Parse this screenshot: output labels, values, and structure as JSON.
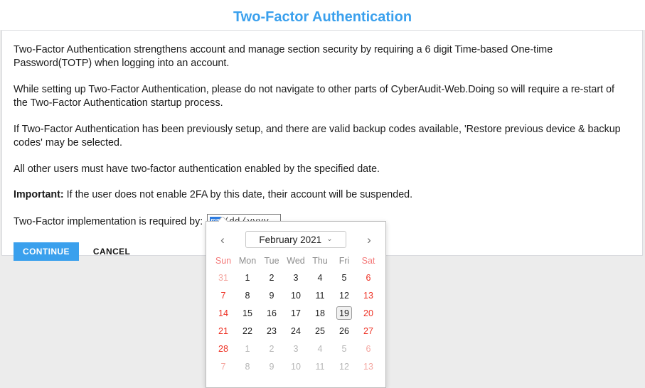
{
  "page": {
    "title": "Two-Factor Authentication"
  },
  "content": {
    "paragraph1": "Two-Factor Authentication strengthens account and manage section security by requiring a 6 digit Time-based One-time Password(TOTP) when logging into an account.",
    "paragraph2": "While setting up Two-Factor Authentication, please do not navigate to other parts of CyberAudit-Web.Doing so will require a re-start of the Two-Factor Authentication startup process.",
    "paragraph3": "If Two-Factor Authentication has been previously setup, and there are valid backup codes available, 'Restore previous device & backup codes' may be selected.",
    "paragraph4": "All other users must have two-factor authentication enabled by the specified date.",
    "important_label": "Important:",
    "important_text": " If the user does not enable 2FA by this date, their account will be suspended.",
    "date_label": "Two-Factor implementation is required by:"
  },
  "date_input": {
    "month_placeholder": "mm",
    "day_placeholder": "dd",
    "year_placeholder": "yyyy",
    "separator": "/",
    "value": "",
    "focused_segment": "mm",
    "highlight_color": "#2f7de1"
  },
  "buttons": {
    "continue_label": "CONTINUE",
    "cancel_label": "CANCEL",
    "continue_color": "#3aa0ed"
  },
  "calendar": {
    "prev_icon": "‹",
    "next_icon": "›",
    "month_year": "February 2021",
    "chevron_icon": "⌄",
    "weekdays": [
      "Sun",
      "Mon",
      "Tue",
      "Wed",
      "Thu",
      "Fri",
      "Sat"
    ],
    "today": 19,
    "weeks": [
      [
        {
          "n": "31",
          "muted": true,
          "weekend": true
        },
        {
          "n": "1",
          "muted": false,
          "weekend": false
        },
        {
          "n": "2",
          "muted": false,
          "weekend": false
        },
        {
          "n": "3",
          "muted": false,
          "weekend": false
        },
        {
          "n": "4",
          "muted": false,
          "weekend": false
        },
        {
          "n": "5",
          "muted": false,
          "weekend": false
        },
        {
          "n": "6",
          "muted": false,
          "weekend": true
        }
      ],
      [
        {
          "n": "7",
          "muted": false,
          "weekend": true
        },
        {
          "n": "8",
          "muted": false,
          "weekend": false
        },
        {
          "n": "9",
          "muted": false,
          "weekend": false
        },
        {
          "n": "10",
          "muted": false,
          "weekend": false
        },
        {
          "n": "11",
          "muted": false,
          "weekend": false
        },
        {
          "n": "12",
          "muted": false,
          "weekend": false
        },
        {
          "n": "13",
          "muted": false,
          "weekend": true
        }
      ],
      [
        {
          "n": "14",
          "muted": false,
          "weekend": true
        },
        {
          "n": "15",
          "muted": false,
          "weekend": false
        },
        {
          "n": "16",
          "muted": false,
          "weekend": false
        },
        {
          "n": "17",
          "muted": false,
          "weekend": false
        },
        {
          "n": "18",
          "muted": false,
          "weekend": false
        },
        {
          "n": "19",
          "muted": false,
          "weekend": false,
          "today": true
        },
        {
          "n": "20",
          "muted": false,
          "weekend": true
        }
      ],
      [
        {
          "n": "21",
          "muted": false,
          "weekend": true
        },
        {
          "n": "22",
          "muted": false,
          "weekend": false
        },
        {
          "n": "23",
          "muted": false,
          "weekend": false
        },
        {
          "n": "24",
          "muted": false,
          "weekend": false
        },
        {
          "n": "25",
          "muted": false,
          "weekend": false
        },
        {
          "n": "26",
          "muted": false,
          "weekend": false
        },
        {
          "n": "27",
          "muted": false,
          "weekend": true
        }
      ],
      [
        {
          "n": "28",
          "muted": false,
          "weekend": true
        },
        {
          "n": "1",
          "muted": true,
          "weekend": false
        },
        {
          "n": "2",
          "muted": true,
          "weekend": false
        },
        {
          "n": "3",
          "muted": true,
          "weekend": false
        },
        {
          "n": "4",
          "muted": true,
          "weekend": false
        },
        {
          "n": "5",
          "muted": true,
          "weekend": false
        },
        {
          "n": "6",
          "muted": true,
          "weekend": true
        }
      ],
      [
        {
          "n": "7",
          "muted": true,
          "weekend": true
        },
        {
          "n": "8",
          "muted": true,
          "weekend": false
        },
        {
          "n": "9",
          "muted": true,
          "weekend": false
        },
        {
          "n": "10",
          "muted": true,
          "weekend": false
        },
        {
          "n": "11",
          "muted": true,
          "weekend": false
        },
        {
          "n": "12",
          "muted": true,
          "weekend": false
        },
        {
          "n": "13",
          "muted": true,
          "weekend": true
        }
      ]
    ]
  }
}
